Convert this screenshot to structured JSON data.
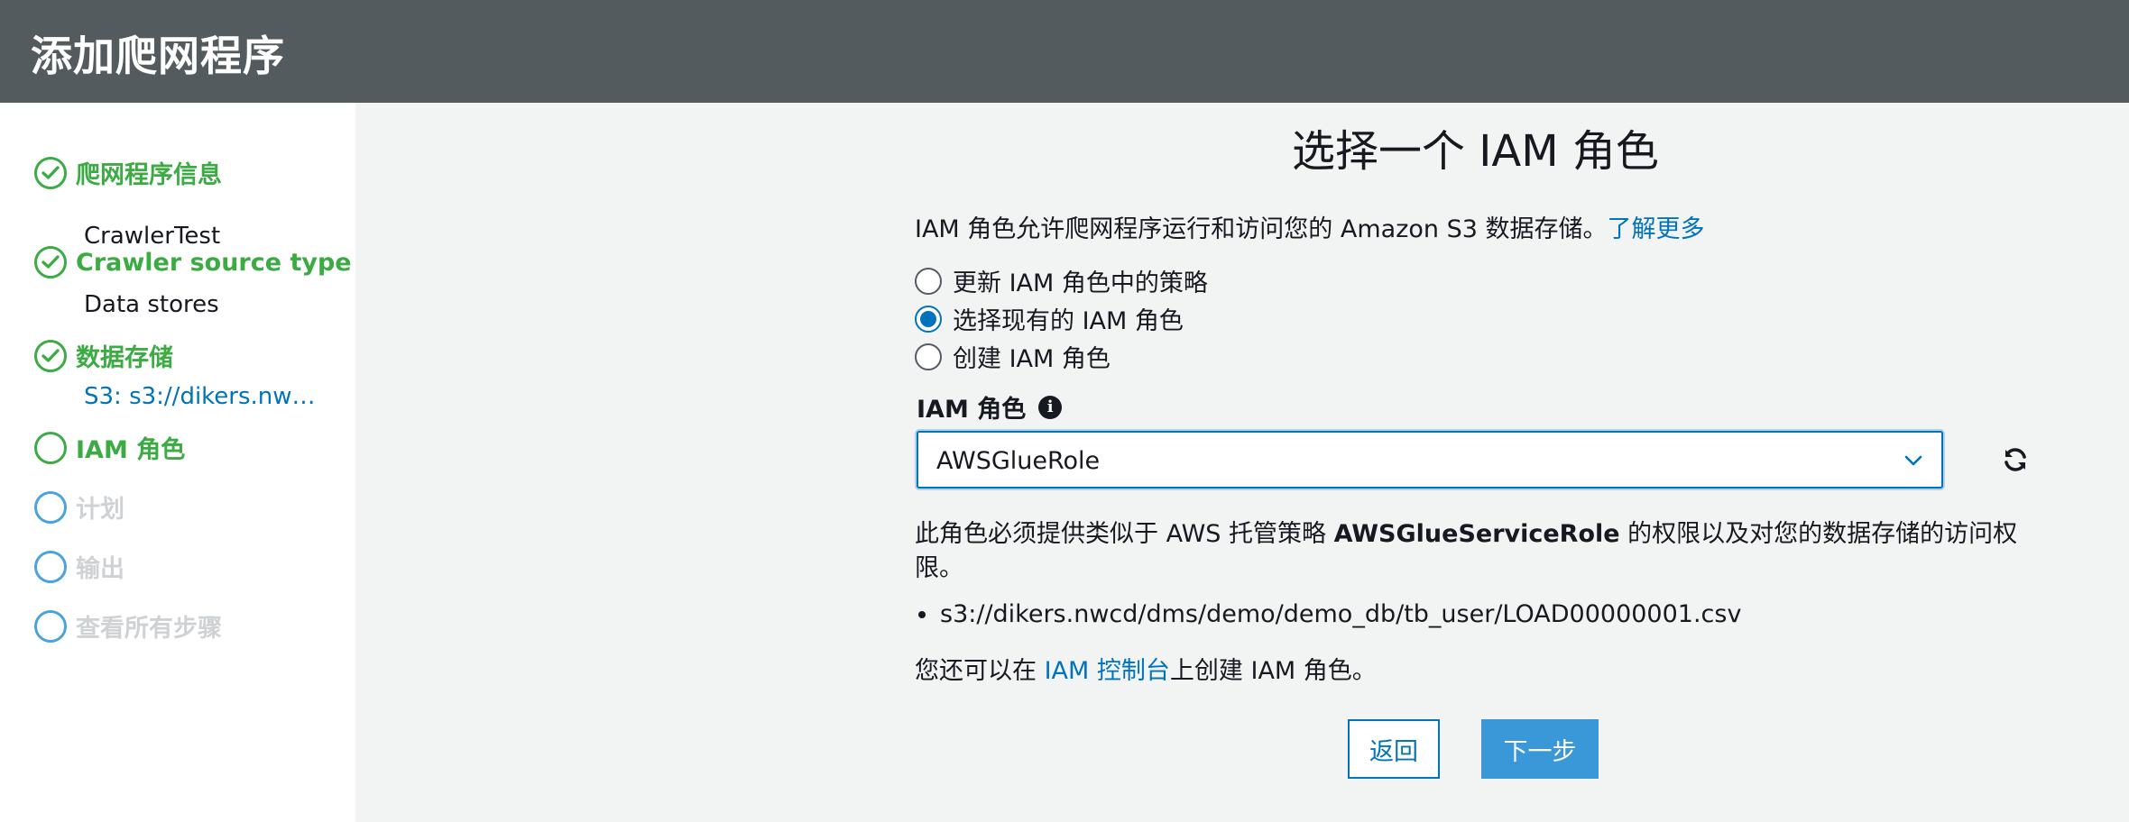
{
  "header": {
    "title": "添加爬网程序"
  },
  "sidebar": {
    "steps": [
      {
        "label": "爬网程序信息",
        "status": "done",
        "sub": "CrawlerTest",
        "sub_is_link": false
      },
      {
        "label": "Crawler source type",
        "status": "done",
        "sub": "Data stores",
        "sub_is_link": false
      },
      {
        "label": "数据存储",
        "status": "done",
        "sub": "S3: s3://dikers.nwcd/dms/demo/demo_db/tb_user/LOAD00000001.csv",
        "sub_is_link": true
      },
      {
        "label": "IAM 角色",
        "status": "current"
      },
      {
        "label": "计划",
        "status": "pending"
      },
      {
        "label": "输出",
        "status": "pending"
      },
      {
        "label": "查看所有步骤",
        "status": "pending"
      }
    ]
  },
  "main": {
    "title": "选择一个 IAM 角色",
    "description": "IAM 角色允许爬网程序运行和访问您的 Amazon S3 数据存储。",
    "learn_more": "了解更多",
    "radio_options": [
      {
        "label": "更新 IAM 角色中的策略",
        "checked": false
      },
      {
        "label": "选择现有的 IAM 角色",
        "checked": true
      },
      {
        "label": "创建 IAM 角色",
        "checked": false
      }
    ],
    "field_label": "IAM 角色",
    "info_icon": "i",
    "selected_role": "AWSGlueRole",
    "note_prefix": "此角色必须提供类似于 AWS 托管策略 ",
    "note_policy": "AWSGlueServiceRole",
    "note_suffix": " 的权限以及对您的数据存储的访问权限。",
    "data_store_path": "s3://dikers.nwcd/dms/demo/demo_db/tb_user/LOAD00000001.csv",
    "also_prefix": "您还可以在 ",
    "also_link": "IAM 控制台",
    "also_suffix": "上创建 IAM 角色。",
    "back_button": "返回",
    "next_button": "下一步"
  },
  "colors": {
    "header_bg": "#545b5f",
    "done_green": "#3cab44",
    "pending_blue": "#4aa3df",
    "link_blue": "#0073bb",
    "primary_button": "#3b98d8"
  }
}
